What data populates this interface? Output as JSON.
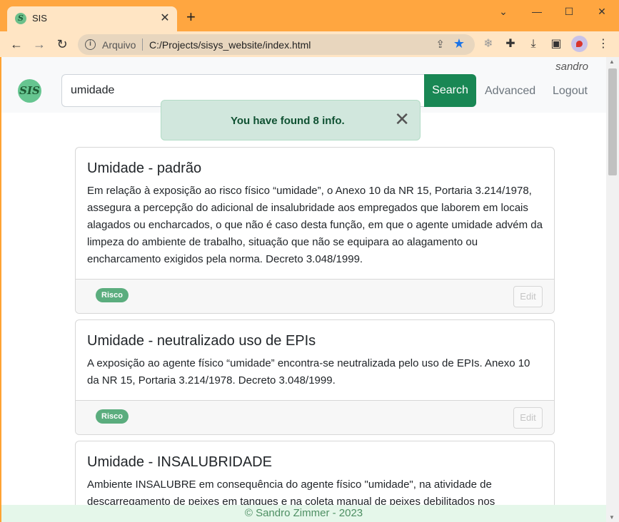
{
  "browser": {
    "tab_title": "SIS",
    "tab_favicon": "S",
    "new_tab_label": "+",
    "address_label": "Arquivo",
    "url": "C:/Projects/sisys_website/index.html"
  },
  "icons": {
    "back": "back-arrow-icon",
    "forward": "forward-arrow-icon",
    "reload": "reload-icon",
    "info": "info-icon",
    "share": "share-icon",
    "bookmark": "star-icon",
    "extensions": "puzzle-icon",
    "download": "download-icon",
    "sidepanel": "side-panel-icon"
  },
  "app": {
    "logo_text": "SIS",
    "user": "sandro",
    "search_value": "umidade",
    "search_label": "Search",
    "advanced_label": "Advanced",
    "logout_label": "Logout",
    "alert_text": "You have found 8 info.",
    "accent_color": "#198754"
  },
  "cards": [
    {
      "title": "Umidade - padrão",
      "text": "Em relação à exposição ao risco físico “umidade”, o Anexo 10 da NR 15, Portaria 3.214/1978, assegura a percepção do adicional de insalubridade aos empregados que laborem em locais alagados ou encharcados, o que não é caso desta função, em que o agente umidade advém da limpeza do ambiente de trabalho, situação que não se equipara ao alagamento ou encharcamento exigidos pela norma. Decreto 3.048/1999.",
      "badge": "Risco",
      "edit_label": "Edit"
    },
    {
      "title": "Umidade - neutralizado uso de EPIs",
      "text": "A exposição ao agente físico “umidade” encontra-se neutralizada pelo uso de EPIs. Anexo 10 da NR 15, Portaria 3.214/1978. Decreto 3.048/1999.",
      "badge": "Risco",
      "edit_label": "Edit"
    },
    {
      "title": "Umidade - INSALUBRIDADE",
      "text": "Ambiente INSALUBRE em consequência do agente físico \"umidade\", na atividade de descarregamento de peixes em tanques e na coleta manual de peixes debilitados nos"
    }
  ],
  "footer": "© Sandro Zimmer - 2023"
}
